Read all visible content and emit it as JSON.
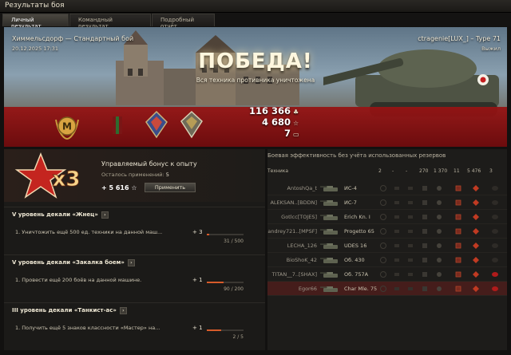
{
  "window": {
    "title": "Результаты боя"
  },
  "tabs": [
    {
      "label": "Личный результат",
      "active": true
    },
    {
      "label": "Командный результат",
      "active": false
    },
    {
      "label": "Подробный отчёт",
      "active": false
    }
  ],
  "hero": {
    "battle_info": "Химмельсдорф — Стандартный бой",
    "date": "20.12.2025 17:31",
    "player": "ctragenie[LUX_] – Type 71",
    "status": "Выжил",
    "result": "ПОБЕДА!",
    "result_sub": "Вся техника противника уничтожена",
    "mastery_letter": "M",
    "rewards": {
      "credits": "116 366",
      "xp": "4 680",
      "bonds": "7"
    }
  },
  "bonus": {
    "multiplier": "x3",
    "title": "Управляемый бонус к опыту",
    "remaining_label": "Осталось применений:",
    "remaining_value": "5",
    "value": "+ 5 616",
    "apply_label": "Применить"
  },
  "missions": [
    {
      "title": "V уровень декали «Жнец»",
      "desc": "1. Уничтожить ещё 500 ед. техники на данной маш...",
      "plus": "+ 3",
      "progress": 0.06,
      "count": "31 / 500"
    },
    {
      "title": "V уровень декали «Закалка боем»",
      "desc": "1. Провести ещё 200 боёв на данной машине.",
      "plus": "+ 1",
      "progress": 0.45,
      "count": "90 / 200"
    },
    {
      "title": "III уровень декали «Танкист-ас»",
      "desc": "1. Получить ещё 5 знаков классности «Мастер» на...",
      "plus": "+ 1",
      "progress": 0.4,
      "count": "2 / 5"
    }
  ],
  "efficiency": {
    "title": "Боевая эффективность без учёта использованных резервов",
    "headers": {
      "vehicle": "Техника",
      "c1": "2",
      "c2": "-",
      "c3": "-",
      "c4": "270",
      "c5": "1 370",
      "c6": "11",
      "c7": "5 476",
      "c8": "3"
    },
    "rows": [
      {
        "player": "AntoshQa_t",
        "tank": "ИС-4",
        "self": false
      },
      {
        "player": "ALEKSAN..[BDDN]",
        "tank": "ИС-7",
        "self": false
      },
      {
        "player": "Gotlcc[TOJES]",
        "tank": "Erich Kn. I",
        "self": false
      },
      {
        "player": "andrey721..[MPSF]",
        "tank": "Progetto 65",
        "self": false
      },
      {
        "player": "LECHA_126",
        "tank": "UDES 16",
        "self": false
      },
      {
        "player": "BioShoK_42",
        "tank": "Об. 430",
        "self": false
      },
      {
        "player": "TITAN__7..[SHAX]",
        "tank": "Об. 757А",
        "self": false
      },
      {
        "player": "Egor66",
        "tank": "Char Mle. 75",
        "self": true
      }
    ]
  },
  "colors": {
    "accent_red": "#b01b1b",
    "gold": "#d9a441",
    "bar_fill": "#d65b2a"
  }
}
